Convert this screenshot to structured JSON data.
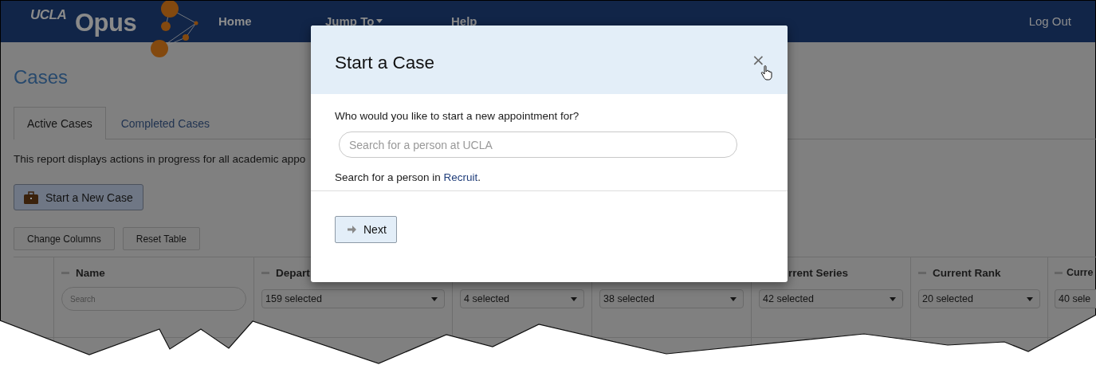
{
  "header": {
    "logo": {
      "university": "UCLA",
      "product": "Opus"
    },
    "nav": [
      {
        "label": "Home",
        "kind": "link"
      },
      {
        "label": "Jump To",
        "kind": "dropdown"
      },
      {
        "label": "Help",
        "kind": "link"
      }
    ],
    "logout": "Log Out"
  },
  "page_title": "Cases",
  "tabs": [
    {
      "label": "Active Cases",
      "selected": true
    },
    {
      "label": "Completed Cases",
      "selected": false
    }
  ],
  "description": "This report displays actions in progress for all academic appo",
  "start_button": "Start a New Case",
  "table_buttons": [
    "Change Columns",
    "Reset Table"
  ],
  "table": {
    "columns": [
      {
        "kind": "select-col"
      },
      {
        "kind": "full",
        "header": "Name",
        "filter": {
          "kind": "search",
          "placeholder": "Search"
        }
      },
      {
        "kind": "full",
        "header": "Depart",
        "filter": {
          "kind": "select",
          "value": "159 selected"
        }
      },
      {
        "kind": "hidden",
        "filter": {
          "kind": "select",
          "value": "4 selected"
        }
      },
      {
        "kind": "hidden",
        "filter": {
          "kind": "select",
          "value": "38 selected"
        }
      },
      {
        "kind": "clipped-left",
        "header": "rrent Series",
        "filter": {
          "kind": "select",
          "value": "42 selected"
        }
      },
      {
        "kind": "full",
        "header": "Current Rank",
        "filter": {
          "kind": "select",
          "value": "20 selected"
        }
      },
      {
        "kind": "full",
        "header": "Curre",
        "filter": {
          "kind": "select",
          "value": "40 sele"
        }
      }
    ]
  },
  "modal": {
    "title": "Start a Case",
    "question": "Who would you like to start a new appointment for?",
    "search": {
      "placeholder": "Search for a person at UCLA"
    },
    "hint": {
      "text": "Search for a person in ",
      "link": "Recruit",
      "end": "."
    },
    "next_button": "Next",
    "close": "×"
  }
}
